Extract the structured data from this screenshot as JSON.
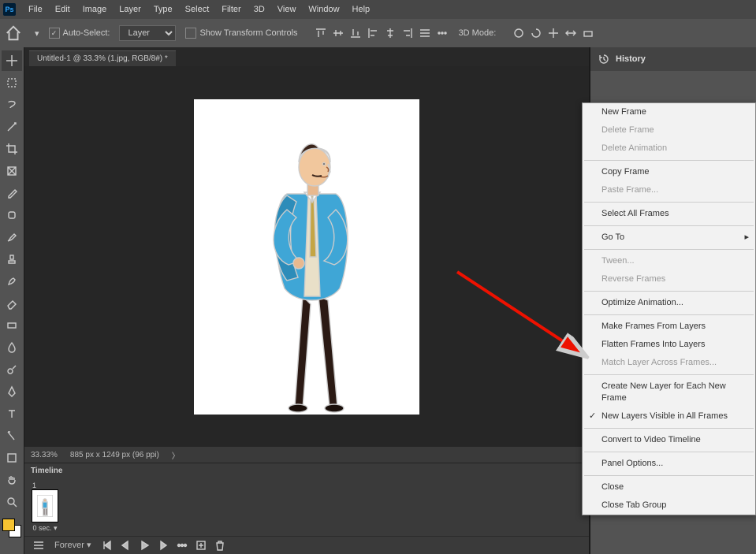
{
  "app_icon_text": "Ps",
  "menubar": [
    "File",
    "Edit",
    "Image",
    "Layer",
    "Type",
    "Select",
    "Filter",
    "3D",
    "View",
    "Window",
    "Help"
  ],
  "options": {
    "auto_select": "Auto-Select:",
    "auto_select_checked": true,
    "layer_dropdown": "Layer",
    "show_transform": "Show Transform Controls",
    "show_transform_checked": false,
    "mode_3d": "3D Mode:"
  },
  "document_tab": "Untitled-1 @ 33.3% (1.jpg, RGB/8#) *",
  "status": {
    "zoom": "33.33%",
    "dims": "885 px x 1249 px (96 ppi)",
    "caret": "〉"
  },
  "timeline": {
    "title": "Timeline",
    "frame_index": "1",
    "frame_duration": "0 sec. ▾",
    "loop": "Forever ▾"
  },
  "right_panel": {
    "title": "History"
  },
  "context_menu": [
    {
      "label": "New Frame"
    },
    {
      "label": "Delete Frame",
      "disabled": true
    },
    {
      "label": "Delete Animation",
      "disabled": true
    },
    {
      "sep": true
    },
    {
      "label": "Copy Frame"
    },
    {
      "label": "Paste Frame...",
      "disabled": true
    },
    {
      "sep": true
    },
    {
      "label": "Select All Frames"
    },
    {
      "sep": true
    },
    {
      "label": "Go To",
      "arrow": true
    },
    {
      "sep": true
    },
    {
      "label": "Tween...",
      "disabled": true
    },
    {
      "label": "Reverse Frames",
      "disabled": true
    },
    {
      "sep": true
    },
    {
      "label": "Optimize Animation..."
    },
    {
      "sep": true
    },
    {
      "label": "Make Frames From Layers"
    },
    {
      "label": "Flatten Frames Into Layers"
    },
    {
      "label": "Match Layer Across Frames...",
      "disabled": true
    },
    {
      "sep": true
    },
    {
      "label": "Create New Layer for Each New Frame"
    },
    {
      "label": "New Layers Visible in All Frames",
      "checked": true
    },
    {
      "sep": true
    },
    {
      "label": "Convert to Video Timeline"
    },
    {
      "sep": true
    },
    {
      "label": "Panel Options..."
    },
    {
      "sep": true
    },
    {
      "label": "Close"
    },
    {
      "label": "Close Tab Group"
    }
  ]
}
